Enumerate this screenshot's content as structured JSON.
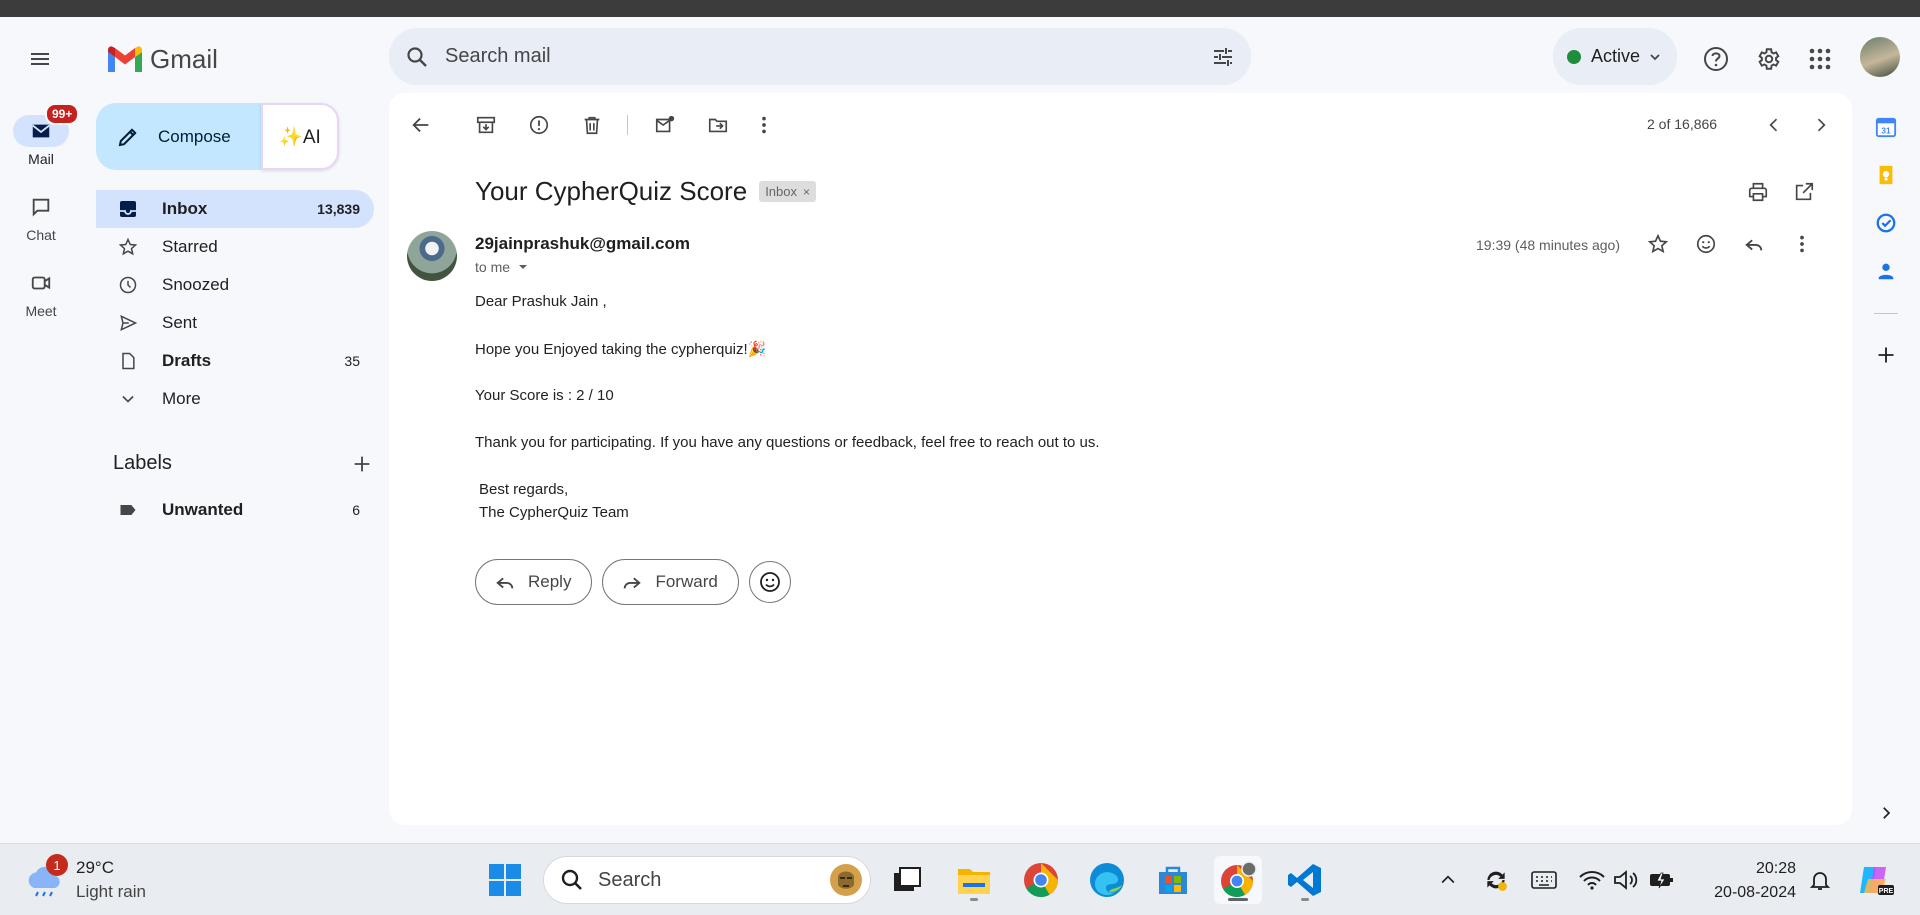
{
  "app": {
    "name": "Gmail"
  },
  "search": {
    "placeholder": "Search mail"
  },
  "status": {
    "label": "Active",
    "color": "#1e8e3e"
  },
  "rail": {
    "mail": {
      "label": "Mail",
      "badge": "99+"
    },
    "chat": {
      "label": "Chat"
    },
    "meet": {
      "label": "Meet"
    }
  },
  "compose": {
    "label": "Compose",
    "ai_label": "✨AI"
  },
  "nav": {
    "items": [
      {
        "label": "Inbox",
        "count": "13,839",
        "icon": "inbox-icon"
      },
      {
        "label": "Starred",
        "count": "",
        "icon": "star-icon"
      },
      {
        "label": "Snoozed",
        "count": "",
        "icon": "clock-icon"
      },
      {
        "label": "Sent",
        "count": "",
        "icon": "send-icon"
      },
      {
        "label": "Drafts",
        "count": "35",
        "icon": "draft-icon"
      },
      {
        "label": "More",
        "count": "",
        "icon": "chevron-down-icon"
      }
    ]
  },
  "labels": {
    "title": "Labels",
    "items": [
      {
        "label": "Unwanted",
        "count": "6"
      }
    ]
  },
  "pager": {
    "text": "2 of 16,866"
  },
  "email": {
    "subject": "Your CypherQuiz Score",
    "chip": "Inbox",
    "chip_close": "×",
    "sender": "29jainprashuk@gmail.com",
    "to": "to me",
    "time": "19:39 (48 minutes ago)",
    "body": {
      "greeting": "Dear Prashuk Jain ,",
      "line1": "Hope you Enjoyed taking the cypherquiz!🎉",
      "line2": "Your Score is : 2 / 10",
      "line3": "Thank you for participating. If you have any questions or feedback, feel free to reach out to us.",
      "sign1": "Best regards,",
      "sign2": "The CypherQuiz Team"
    },
    "reply_label": "Reply",
    "forward_label": "Forward"
  },
  "taskbar": {
    "weather": {
      "temp": "29°C",
      "condition": "Light rain",
      "badge": "1"
    },
    "search_label": "Search",
    "time": "20:28",
    "date": "20-08-2024"
  },
  "colors": {
    "accent": "#0b57d0",
    "nav_active": "#d3e3fd",
    "compose_bg": "#c2e7ff",
    "badge_red": "#c5221f"
  }
}
